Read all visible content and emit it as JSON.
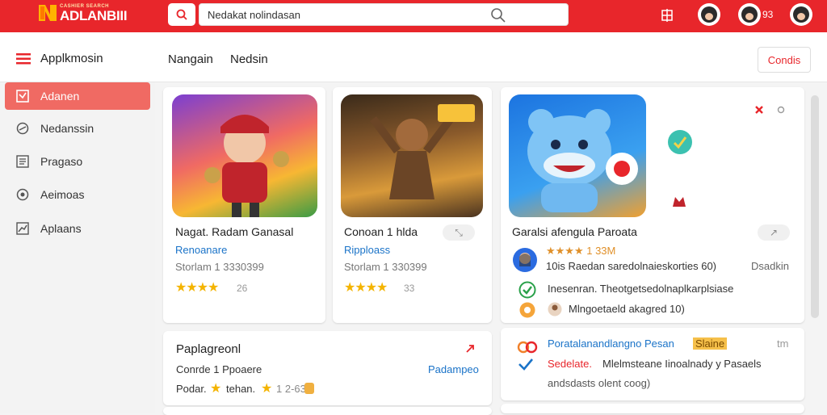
{
  "brand": {
    "tagline": "CASHIER SEARCH",
    "name": "ADLANBIII"
  },
  "search": {
    "value": "Nedakat nolindasan"
  },
  "topbar": {
    "notification_count": "93"
  },
  "sidebar": {
    "title": "Applkmosin",
    "items": [
      {
        "label": "Adanen",
        "icon": "app-icon",
        "active": true
      },
      {
        "label": "Nedanssin",
        "icon": "compass-icon"
      },
      {
        "label": "Pragaso",
        "icon": "list-icon"
      },
      {
        "label": "Aeimoas",
        "icon": "target-icon"
      },
      {
        "label": "Aplaans",
        "icon": "chart-icon"
      }
    ]
  },
  "subheader": {
    "tabs": [
      "Nangain",
      "Nedsin"
    ],
    "action": "Condis"
  },
  "cards": [
    {
      "title": "Nagat. Radam Ganasal",
      "subtitle": "Renoanare",
      "meta": "Storlam 1 3330399",
      "rating": "★★★★",
      "count": "26"
    },
    {
      "title": "Conoan 1 hlda",
      "subtitle": "Ripploass",
      "meta": "Storlam 1 330399",
      "rating": "★★★★",
      "count": "33",
      "pill": "⤡"
    },
    {
      "title": "Garalsi afengula Paroata",
      "pill": "↗",
      "rating_line": "★★★★ 1 33M",
      "line1": "10is Raedan saredolnaieskorties 60)",
      "line1_tag": "Dsadkin",
      "line2": "Inesenran. Theotgetsedolnaplkarplsiase",
      "line3": "Mlngoetaeld akagred 10)"
    }
  ],
  "panel_small": {
    "title": "Paplagreonl",
    "row1": "Conrde 1 Ppoaere",
    "row1_link": "Padampeo",
    "row2": "Podar.",
    "row2_tag": "tehan.",
    "row2_count": "1 2-63"
  },
  "panel_right": {
    "line1": "Poratalanandlangno Pesan",
    "line1_badge": "Slaine",
    "line1_right": "tm",
    "line2": "Sedelate.",
    "line2_rest": "Mlelmsteane Iinoalnady y Pasaels",
    "line3": "andsdasts olent coog)"
  },
  "colors": {
    "brand_red": "#e8262b",
    "active_nav": "#f06a63",
    "link_blue": "#1a73c8",
    "star": "#f4b400"
  }
}
